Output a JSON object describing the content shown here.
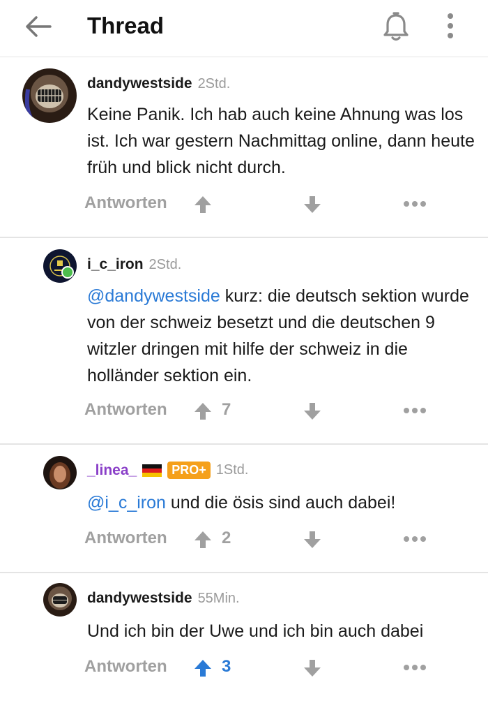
{
  "header": {
    "title": "Thread"
  },
  "comments": [
    {
      "username": "dandywestside",
      "time": "2Std.",
      "segments": [
        {
          "text": "Keine Panik. Ich hab auch keine Ahnung was los ist. Ich war gestern Nachmittag online, dann heute früh und blick nicht durch.",
          "mention": false
        }
      ],
      "reply_label": "Antworten",
      "score": "",
      "upvoted": false
    },
    {
      "username": "i_c_iron",
      "time": "2Std.",
      "online": true,
      "segments": [
        {
          "text": "@dandywestside",
          "mention": true
        },
        {
          "text": " kurz: die deutsch sektion wurde von der schweiz besetzt und die deutschen 9 witzler dringen mit hilfe der schweiz in die holländer sektion ein.",
          "mention": false
        }
      ],
      "reply_label": "Antworten",
      "score": "7",
      "upvoted": false
    },
    {
      "username": "_linea_",
      "time": "1Std.",
      "flag": "de-flag",
      "badge": "PRO+",
      "segments": [
        {
          "text": "@i_c_iron",
          "mention": true
        },
        {
          "text": " und die ösis sind auch dabei!",
          "mention": false
        }
      ],
      "reply_label": "Antworten",
      "score": "2",
      "upvoted": false
    },
    {
      "username": "dandywestside",
      "time": "55Min.",
      "segments": [
        {
          "text": "Und ich bin der Uwe und ich bin auch dabei",
          "mention": false
        }
      ],
      "reply_label": "Antworten",
      "score": "3",
      "upvoted": true
    }
  ],
  "colors": {
    "mention": "#2a7ad6",
    "muted": "#a0a0a0",
    "badge": "#f5a01a",
    "divider": "#e4e4e4"
  },
  "icons": [
    "back-arrow-icon",
    "bell-icon",
    "more-vertical-icon",
    "upvote-arrow-icon",
    "downvote-arrow-icon",
    "more-horizontal-icon"
  ]
}
